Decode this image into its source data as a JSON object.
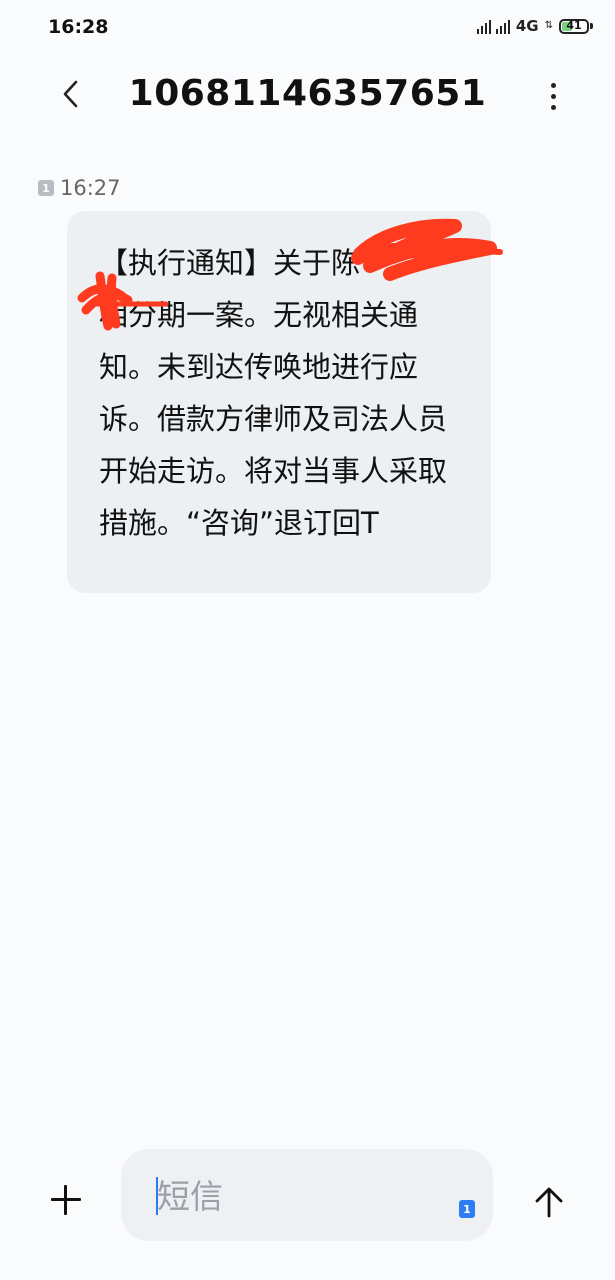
{
  "status_bar": {
    "time": "16:28",
    "network": "4G",
    "battery": "41",
    "battery_level_percent": 41,
    "icons": [
      "signal-icon",
      "data-arrows-icon",
      "battery-icon"
    ]
  },
  "header": {
    "title": "10681146357651",
    "icons": [
      "back-arrow-icon",
      "more-options-icon"
    ]
  },
  "message": {
    "sim_slot": "1",
    "time": "16:27",
    "body": "【执行通知】关于陈　　　　　 相分期一案。无视相关通知。未到达传唤地进行应诉。借款方律师及司法人员开始走访。将对当事人采取措施。“咨询”退订回T"
  },
  "composer": {
    "placeholder": "短信",
    "value": "",
    "sim_slot": "1",
    "icons": [
      "add-icon",
      "send-arrow-icon"
    ]
  },
  "colors": {
    "background": "#fafbfd",
    "bubble": "#edf0f3",
    "composer": "#eef0f4",
    "accent": "#2f7df2",
    "redaction": "#ff3b1f"
  }
}
